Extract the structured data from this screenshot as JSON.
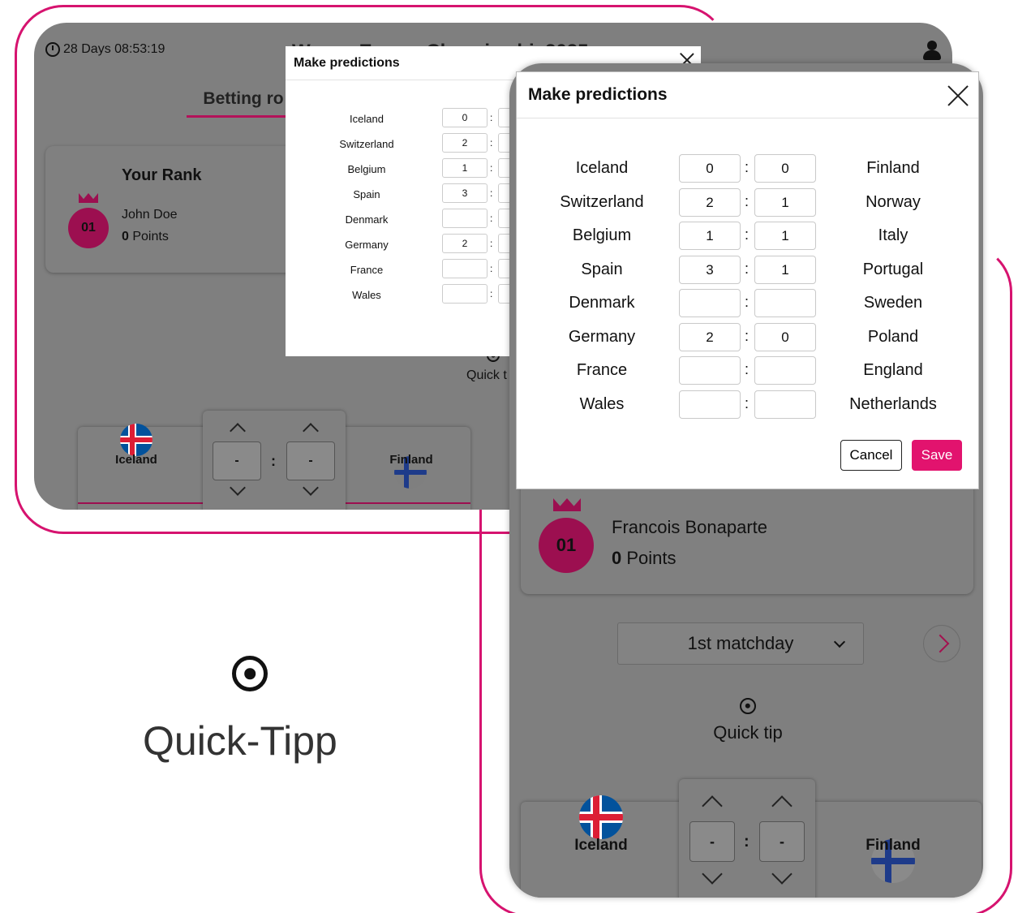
{
  "left_screen": {
    "timer": "28 Days 08:53:19",
    "header_title_partial": "W         E          Ch      i     hi  2025",
    "tab_betting": "Betting ro",
    "rank_card": {
      "title": "Your Rank",
      "rank": "01",
      "name": "John Doe",
      "points_value": "0",
      "points_label": "Points"
    },
    "quick_tip_partial": "Quick t",
    "match": {
      "home_team": "Iceland",
      "away_team": "Finland",
      "home_score": "-",
      "away_score": "-",
      "separator": ":"
    }
  },
  "modal_small": {
    "title": "Make predictions",
    "rows": [
      {
        "home": "Iceland",
        "home_score": "0"
      },
      {
        "home": "Switzerland",
        "home_score": "2"
      },
      {
        "home": "Belgium",
        "home_score": "1"
      },
      {
        "home": "Spain",
        "home_score": "3"
      },
      {
        "home": "Denmark",
        "home_score": ""
      },
      {
        "home": "Germany",
        "home_score": "2"
      },
      {
        "home": "France",
        "home_score": ""
      },
      {
        "home": "Wales",
        "home_score": ""
      }
    ],
    "separator": ":"
  },
  "modal_big": {
    "title": "Make predictions",
    "rows": [
      {
        "home": "Iceland",
        "home_score": "0",
        "away_score": "0",
        "away": "Finland"
      },
      {
        "home": "Switzerland",
        "home_score": "2",
        "away_score": "1",
        "away": "Norway"
      },
      {
        "home": "Belgium",
        "home_score": "1",
        "away_score": "1",
        "away": "Italy"
      },
      {
        "home": "Spain",
        "home_score": "3",
        "away_score": "1",
        "away": "Portugal"
      },
      {
        "home": "Denmark",
        "home_score": "",
        "away_score": "",
        "away": "Sweden"
      },
      {
        "home": "Germany",
        "home_score": "2",
        "away_score": "0",
        "away": "Poland"
      },
      {
        "home": "France",
        "home_score": "",
        "away_score": "",
        "away": "England"
      },
      {
        "home": "Wales",
        "home_score": "",
        "away_score": "",
        "away": "Netherlands"
      }
    ],
    "separator": ":",
    "cancel_label": "Cancel",
    "save_label": "Save"
  },
  "right_screen": {
    "rank_card": {
      "rank": "01",
      "name": "Francois Bonaparte",
      "points_value": "0",
      "points_label": "Points"
    },
    "matchday_select": "1st matchday",
    "quick_tip": "Quick tip",
    "match": {
      "home_team": "Iceland",
      "away_team": "Finland",
      "home_score": "-",
      "away_score": "-",
      "separator": ":"
    }
  },
  "callout": {
    "quick_tipp_label": "Quick-Tipp"
  },
  "colors": {
    "accent": "#e2136e",
    "frame": "#d6136f",
    "badge": "#9c0f50",
    "overlay_gray": "#7f7f7f"
  },
  "icons": [
    "clock-icon",
    "user-icon",
    "crown-icon",
    "close-icon",
    "chevron-up-icon",
    "chevron-down-icon",
    "chevron-right-icon",
    "target-icon",
    "iceland-flag-icon",
    "finland-flag-icon"
  ]
}
